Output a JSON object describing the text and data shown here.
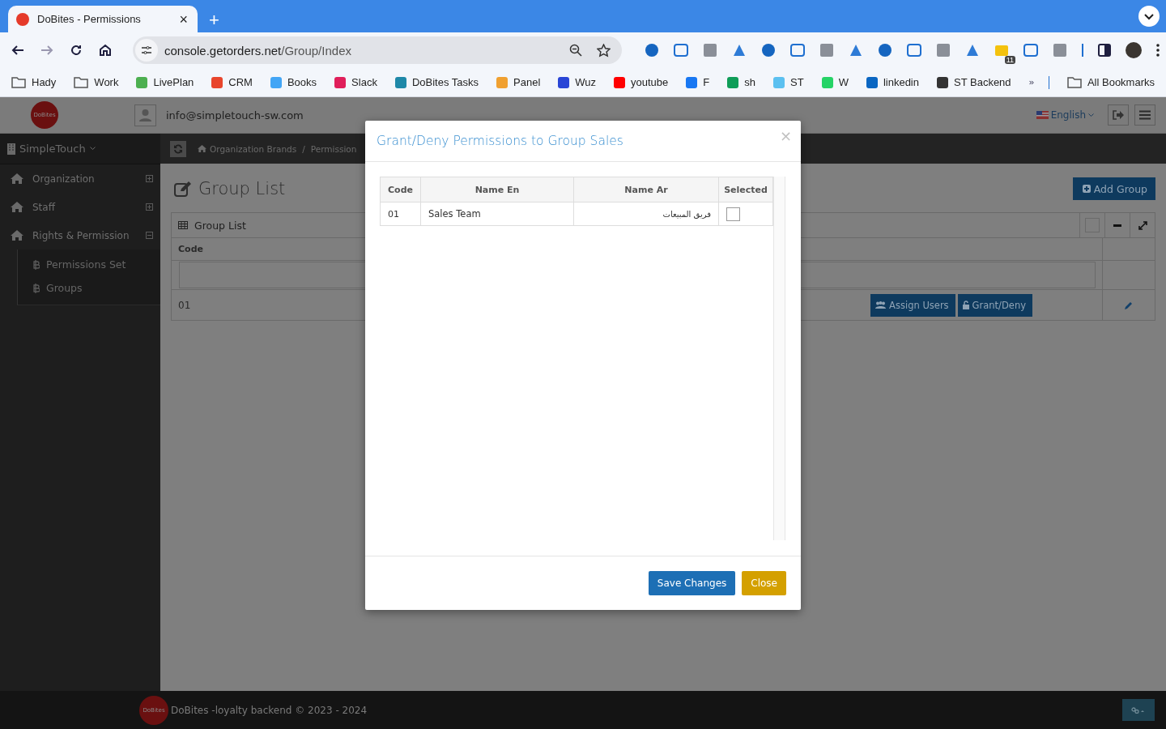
{
  "browser": {
    "tab": {
      "title": "DoBites - Permissions",
      "close": "×"
    },
    "new_tab": "+",
    "address": {
      "host": "console.getorders.net",
      "path": "/Group/Index"
    },
    "extension_badge": "11",
    "bookmarks": [
      {
        "label": "Hady",
        "kind": "folder"
      },
      {
        "label": "Work",
        "kind": "folder"
      },
      {
        "label": "LivePlan",
        "kind": "site",
        "color": "#4caf50"
      },
      {
        "label": "CRM",
        "kind": "site",
        "color": "#e8452c"
      },
      {
        "label": "Books",
        "kind": "site",
        "color": "#42a5f5"
      },
      {
        "label": "Slack",
        "kind": "site",
        "color": "#e01e5a"
      },
      {
        "label": "DoBites Tasks",
        "kind": "site",
        "color": "#1e88a8"
      },
      {
        "label": "Panel",
        "kind": "site",
        "color": "#f0a030"
      },
      {
        "label": "Wuz",
        "kind": "site",
        "color": "#2945d6"
      },
      {
        "label": "youtube",
        "kind": "site",
        "color": "#ff0000"
      },
      {
        "label": "F",
        "kind": "site",
        "color": "#1877f2"
      },
      {
        "label": "sh",
        "kind": "site",
        "color": "#0f9d58"
      },
      {
        "label": "ST",
        "kind": "site",
        "color": "#5bc0f0"
      },
      {
        "label": "W",
        "kind": "site",
        "color": "#25d366"
      },
      {
        "label": "linkedin",
        "kind": "site",
        "color": "#0a66c2"
      },
      {
        "label": "ST Backend",
        "kind": "site",
        "color": "#333333"
      }
    ],
    "all_bookmarks": "All Bookmarks"
  },
  "header": {
    "logo_text": "DoBites",
    "user_email": "info@simpletouch-sw.com",
    "language": "English"
  },
  "sidebar": {
    "org": "SimpleTouch",
    "items": [
      {
        "label": "Organization",
        "expanded": false
      },
      {
        "label": "Staff",
        "expanded": false
      },
      {
        "label": "Rights & Permission",
        "expanded": true,
        "children": [
          {
            "label": "Permissions Set"
          },
          {
            "label": "Groups"
          }
        ]
      }
    ]
  },
  "breadcrumb": {
    "items": [
      "Organization Brands",
      "Permission"
    ],
    "separator": "/"
  },
  "page": {
    "title": "Group List",
    "add_button": "Add Group",
    "panel": {
      "title": "Group List",
      "columns": [
        "Code"
      ],
      "rows": [
        {
          "code": "01",
          "actions": [
            "Assign Users",
            "Grant/Deny"
          ]
        }
      ]
    }
  },
  "modal": {
    "title": "Grant/Deny Permissions to Group Sales",
    "close": "×",
    "columns": [
      "Code",
      "Name En",
      "Name Ar",
      "Selected"
    ],
    "rows": [
      {
        "code": "01",
        "name_en": "Sales Team",
        "name_ar": "فريق المبيعات",
        "checked": false
      }
    ],
    "save": "Save Changes",
    "dismiss": "Close"
  },
  "footer": {
    "logo_text": "DoBites",
    "text": "DoBites -loyalty backend © 2023 - 2024"
  }
}
